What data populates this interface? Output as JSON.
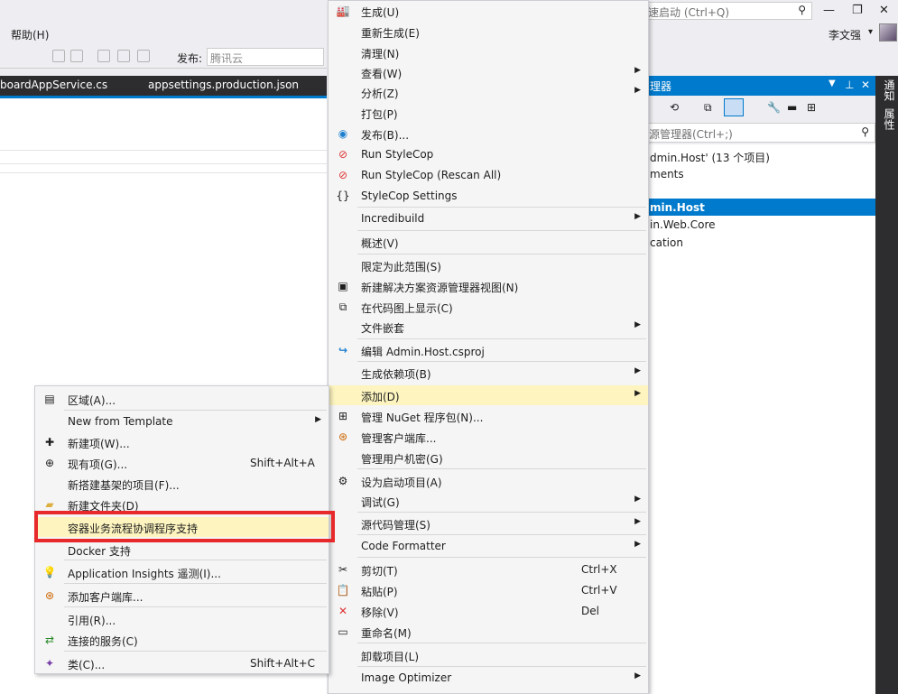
{
  "window": {
    "quick_launch_placeholder": "速启动 (Ctrl+Q)",
    "minimize": "—",
    "restore": "❐",
    "close": "✕",
    "user_name": "李文强",
    "user_dropdown": "▾"
  },
  "menubar": {
    "help": "帮助(H)"
  },
  "toolbar": {
    "publish_label": "发布:",
    "publish_target": "腾讯云"
  },
  "tabs": [
    {
      "label": "boardAppService.cs"
    },
    {
      "label": "appsettings.production.json"
    }
  ],
  "solution_explorer": {
    "title": "理器",
    "title_icons": [
      "▼",
      "⊥",
      "✕"
    ],
    "search_placeholder": "源管理器(Ctrl+;)",
    "tree": [
      {
        "label": "dmin.Host' (13 个项目)"
      },
      {
        "label": "ments"
      },
      {
        "label": "min.Host",
        "selected": true
      },
      {
        "label": "in.Web.Core"
      },
      {
        "label": "cation"
      }
    ]
  },
  "sidebar_tabs": [
    "通知",
    "属性"
  ],
  "project_menu": {
    "items": [
      {
        "label": "生成(U)",
        "icon": "build-icon"
      },
      {
        "label": "重新生成(E)"
      },
      {
        "label": "清理(N)"
      },
      {
        "label": "查看(W)",
        "submenu": true
      },
      {
        "label": "分析(Z)",
        "submenu": true
      },
      {
        "label": "打包(P)"
      },
      {
        "label": "发布(B)...",
        "icon": "globe-icon"
      },
      {
        "label": "Run StyleCop",
        "icon": "stylecop-icon"
      },
      {
        "label": "Run StyleCop (Rescan All)",
        "icon": "stylecop-icon"
      },
      {
        "label": "StyleCop Settings",
        "icon": "braces-icon"
      },
      {
        "label": "Incredibuild",
        "submenu": true
      },
      {
        "label": "概述(V)"
      },
      {
        "label": "限定为此范围(S)"
      },
      {
        "label": "新建解决方案资源管理器视图(N)",
        "icon": "new-view-icon"
      },
      {
        "label": "在代码图上显示(C)",
        "icon": "code-map-icon"
      },
      {
        "label": "文件嵌套",
        "submenu": true
      },
      {
        "label": "编辑 Admin.Host.csproj",
        "icon": "edit-arrow-icon"
      },
      {
        "label": "生成依赖项(B)",
        "submenu": true
      },
      {
        "label": "添加(D)",
        "submenu": true,
        "highlighted": true
      },
      {
        "label": "管理 NuGet 程序包(N)...",
        "icon": "nuget-icon"
      },
      {
        "label": "管理客户端库...",
        "icon": "library-icon"
      },
      {
        "label": "管理用户机密(G)"
      },
      {
        "label": "设为启动项目(A)",
        "icon": "gear-icon"
      },
      {
        "label": "调试(G)",
        "submenu": true
      },
      {
        "label": "源代码管理(S)",
        "submenu": true
      },
      {
        "label": "Code Formatter",
        "submenu": true
      },
      {
        "label": "剪切(T)",
        "shortcut": "Ctrl+X",
        "icon": "scissors-icon"
      },
      {
        "label": "粘贴(P)",
        "shortcut": "Ctrl+V",
        "icon": "paste-icon"
      },
      {
        "label": "移除(V)",
        "shortcut": "Del",
        "icon": "remove-icon"
      },
      {
        "label": "重命名(M)",
        "icon": "rename-icon"
      },
      {
        "label": "卸载项目(L)"
      },
      {
        "label": "Image Optimizer",
        "submenu": true
      }
    ]
  },
  "add_menu": {
    "items": [
      {
        "label": "区域(A)...",
        "icon": "area-icon"
      },
      {
        "label": "New from Template",
        "submenu": true
      },
      {
        "label": "新建项(W)...",
        "icon": "new-item-icon"
      },
      {
        "label": "现有项(G)...",
        "shortcut": "Shift+Alt+A",
        "icon": "existing-item-icon"
      },
      {
        "label": "新搭建基架的项目(F)..."
      },
      {
        "label": "新建文件夹(D)",
        "icon": "new-folder-icon"
      },
      {
        "label": "容器业务流程协调程序支持",
        "highlighted": true
      },
      {
        "label": "Docker 支持"
      },
      {
        "label": "Application Insights 遥测(I)...",
        "icon": "insights-icon"
      },
      {
        "label": "添加客户端库...",
        "icon": "library-icon"
      },
      {
        "label": "引用(R)..."
      },
      {
        "label": "连接的服务(C)",
        "icon": "connected-services-icon"
      },
      {
        "label": "类(C)...",
        "shortcut": "Shift+Alt+C",
        "icon": "class-icon"
      }
    ]
  }
}
